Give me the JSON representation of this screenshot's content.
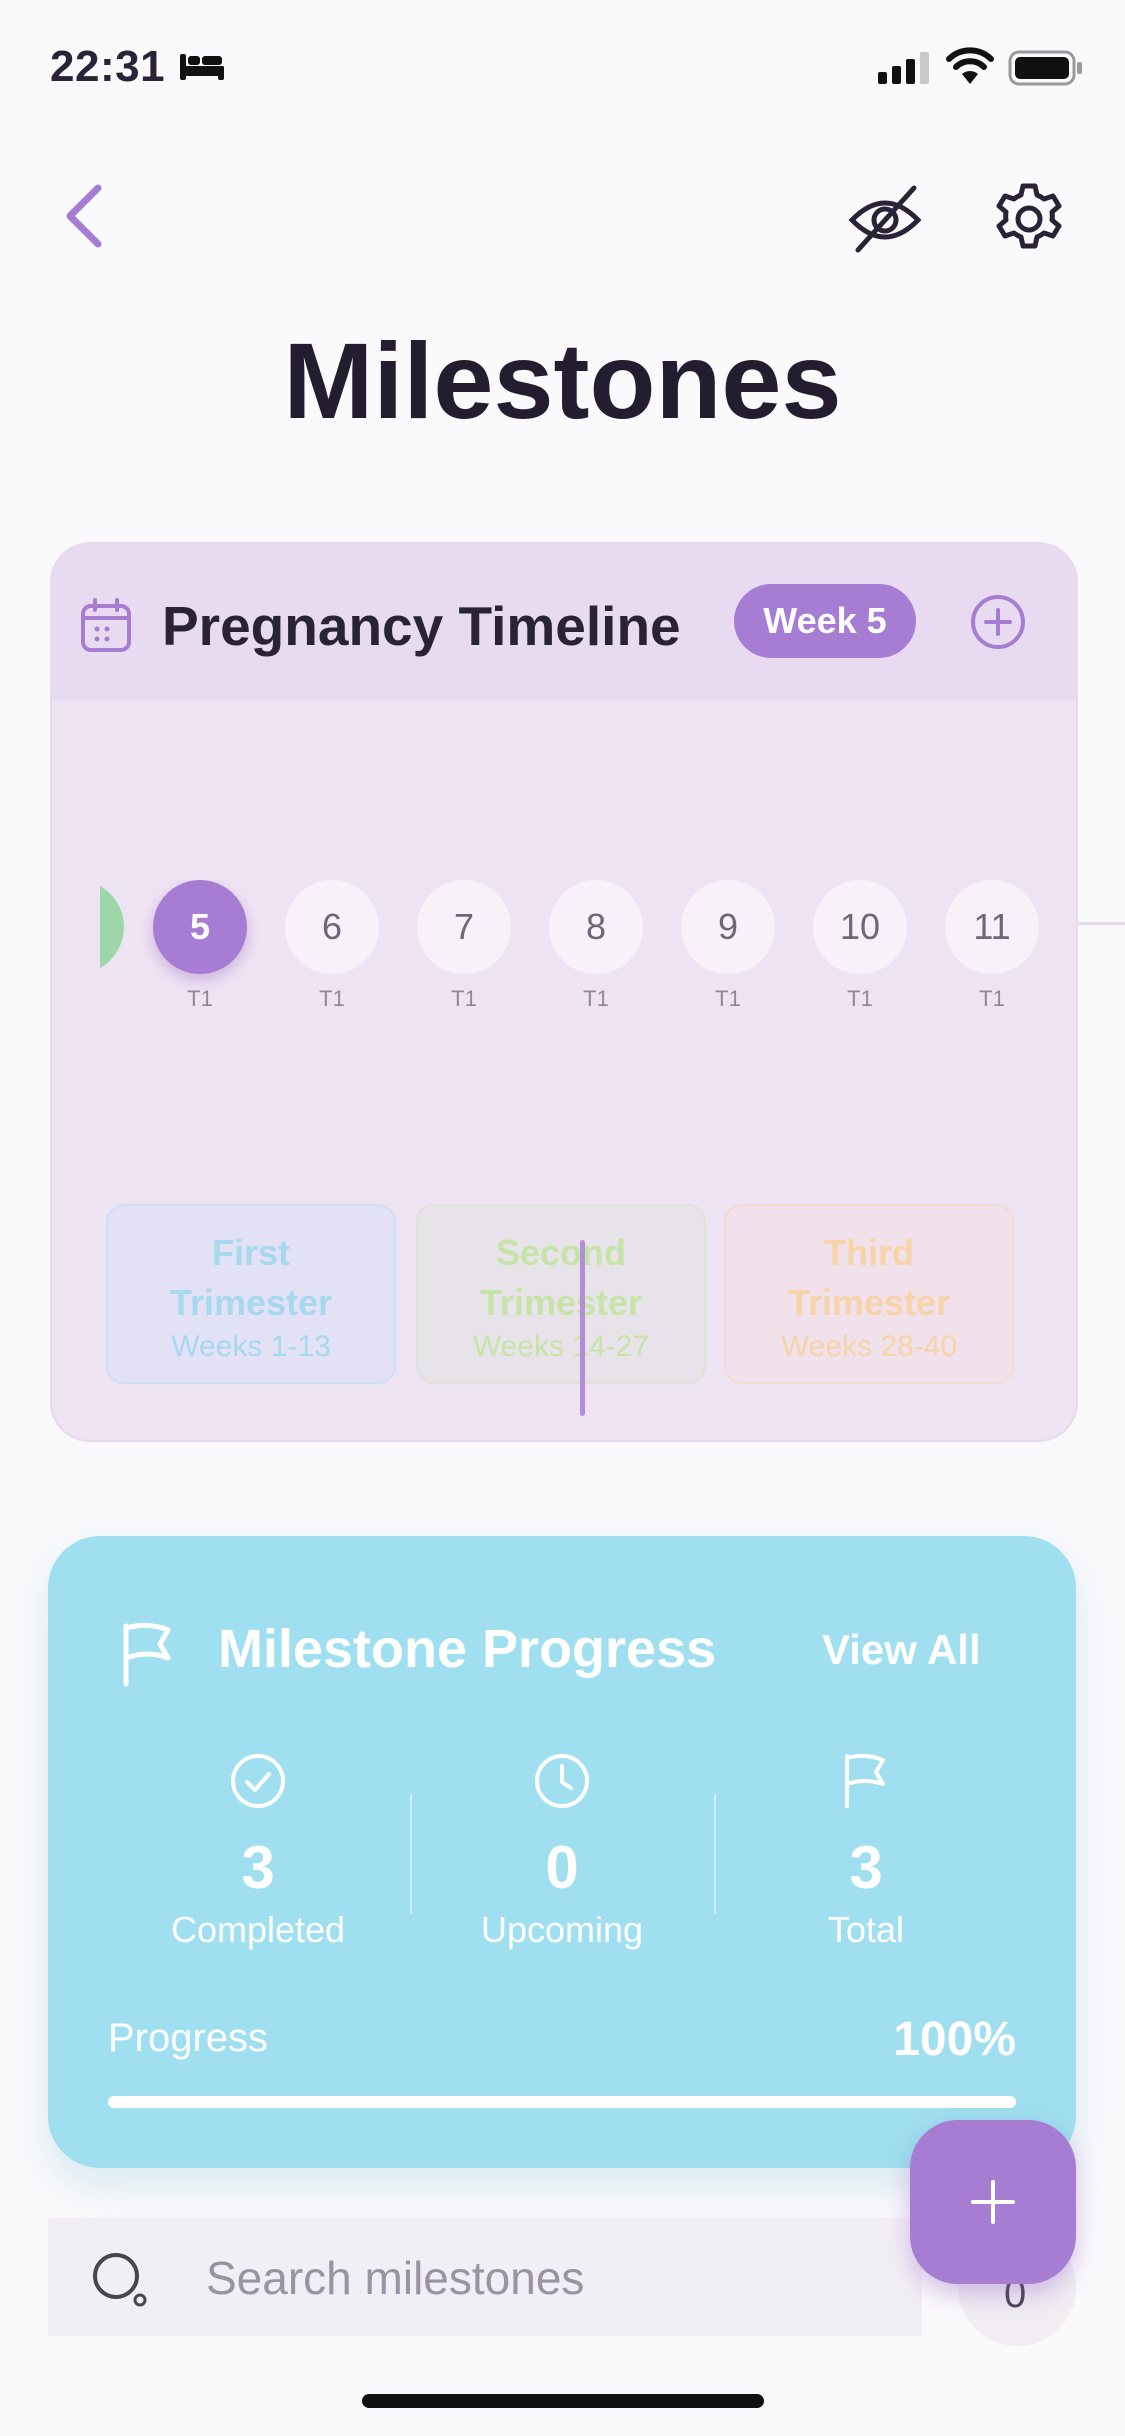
{
  "status_bar": {
    "time": "22:31"
  },
  "header": {
    "title": "Milestones"
  },
  "timeline": {
    "title": "Pregnancy Timeline",
    "week_badge": "Week 5",
    "weeks": [
      {
        "number": "5",
        "trimester": "T1",
        "active": true
      },
      {
        "number": "6",
        "trimester": "T1"
      },
      {
        "number": "7",
        "trimester": "T1"
      },
      {
        "number": "8",
        "trimester": "T1"
      },
      {
        "number": "9",
        "trimester": "T1"
      },
      {
        "number": "10",
        "trimester": "T1"
      },
      {
        "number": "11",
        "trimester": "T1"
      }
    ],
    "trimesters": [
      {
        "name_line1": "First",
        "name_line2": "Trimester",
        "weeks": "Weeks 1-13"
      },
      {
        "name_line1": "Second",
        "name_line2": "Trimester",
        "weeks": "Weeks 14-27"
      },
      {
        "name_line1": "Third",
        "name_line2": "Trimester",
        "weeks": "Weeks 28-40"
      }
    ]
  },
  "progress_card": {
    "title": "Milestone Progress",
    "view_all": "View All",
    "stats": [
      {
        "value": "3",
        "label": "Completed",
        "icon": "check-circle-icon"
      },
      {
        "value": "0",
        "label": "Upcoming",
        "icon": "clock-icon"
      },
      {
        "value": "3",
        "label": "Total",
        "icon": "flag-icon"
      }
    ],
    "progress_label": "Progress",
    "progress_value": "100%",
    "progress_fraction": 1.0
  },
  "search": {
    "placeholder": "Search milestones"
  },
  "filter_ghost_text": "0",
  "colors": {
    "accent_purple": "#A77DD3",
    "progress_card": "#9FDFEF",
    "first_trimester": "#A6D8EE",
    "second_trimester": "#C6E4A8",
    "third_trimester": "#F6D3A8"
  }
}
